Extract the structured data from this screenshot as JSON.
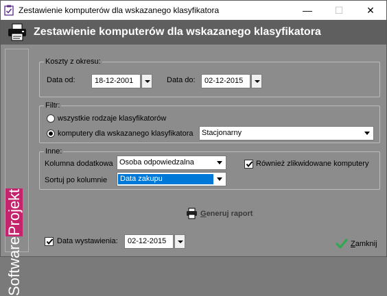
{
  "window": {
    "title": "Zestawienie komputerów dla wskazanego klasyfikatora",
    "minimize_glyph": "—",
    "maximize_glyph": "☐",
    "close_glyph": "✕"
  },
  "header": {
    "heading": "Zestawienie komputerów dla wskazanego klasyfikatora",
    "icon": "printer-icon"
  },
  "brand": {
    "part1": "Software",
    "part2": "Projekt",
    "highlight_color": "#c4246c"
  },
  "costs": {
    "title": "Koszty z okresu:",
    "date_from_label": "Data od:",
    "date_from_value": "18-12-2001",
    "date_to_label": "Data do:",
    "date_to_value": "02-12-2015"
  },
  "filter": {
    "title": "Filtr:",
    "option_all": "wszystkie rodzaje klasyfikatorów",
    "option_selected": "komputery dla wskazanego klasyfikatora",
    "selected_option": "option_selected",
    "classifier_value": "Stacjonarny"
  },
  "other": {
    "title": "Inne:",
    "extra_column_label": "Kolumna dodatkowa",
    "extra_column_value": "Osoba odpowiedzalna",
    "sort_label": "Sortuj po kolumnie",
    "sort_value": "Data zakupu",
    "include_liquidated_label": "Również zlikwidowane komputery",
    "include_liquidated_checked": true
  },
  "actions": {
    "generate_first": "G",
    "generate_rest": "eneruj raport",
    "issue_date_label": "Data wystawienia:",
    "issue_date_value": "02-12-2015",
    "issue_date_checked": true,
    "close_first": "Z",
    "close_rest": "amknij",
    "accent": "#2fa84f"
  }
}
